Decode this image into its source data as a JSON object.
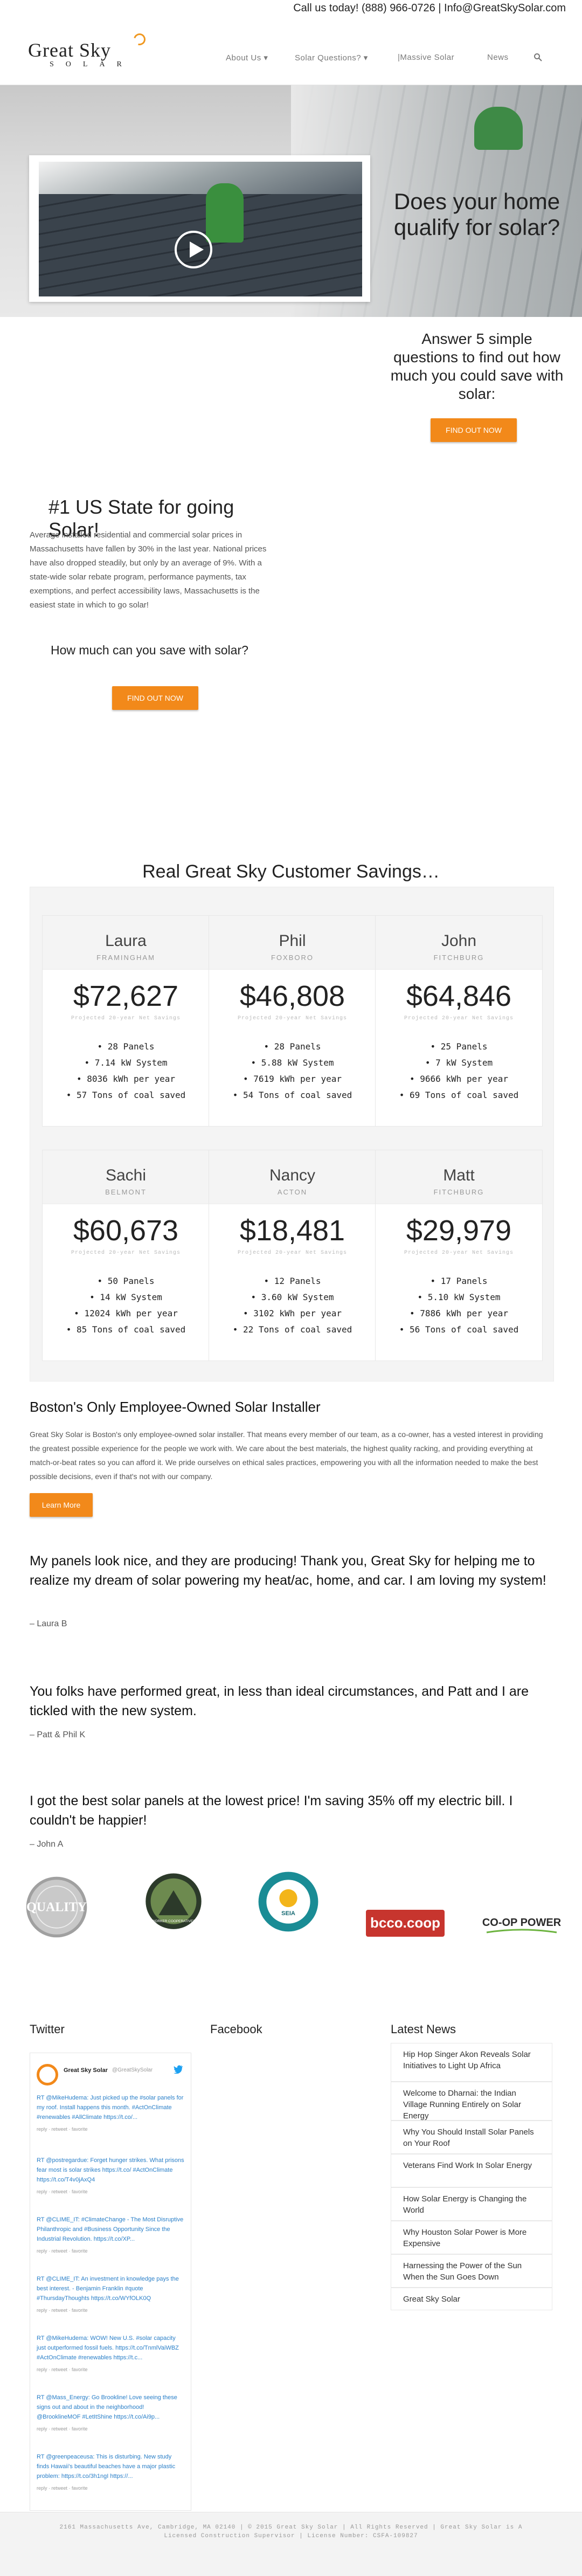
{
  "topbar": {
    "text": "Call us today! (888) 966-0726 | Info@GreatSkySolar.com"
  },
  "brand": {
    "line1": "Great Sky",
    "line2": "SOLAR"
  },
  "nav": {
    "about": "About Us ▾",
    "questions": "Solar Questions? ▾",
    "massive": "|Massive Solar",
    "news": "News",
    "search_icon": "search-icon"
  },
  "hero": {
    "headline": "Does your home qualify for solar?",
    "sub": "Answer 5 simple questions to find out how much you could save with solar:",
    "cta": "FIND OUT NOW"
  },
  "intro": {
    "title": "#1 US State for going Solar!",
    "body": "Average installed residential and commercial solar prices in Massachusetts have fallen by 30% in the last year. National prices have also dropped steadily, but only by an average of 9%. With a state-wide solar rebate program, performance payments, tax exemptions, and perfect accessibility laws, Massachusetts is the easiest state in which to go solar!",
    "question": "How much can you save with solar?",
    "cta": "FIND OUT NOW"
  },
  "savings": {
    "title": "Real Great Sky Customer Savings…",
    "note": "Projected 20-year Net Savings",
    "customers": [
      {
        "name": "Laura",
        "city": "FRAMINGHAM",
        "amount": "$72,627",
        "items": [
          "• 28 Panels",
          "• 7.14 kW System",
          "• 8036 kWh per year",
          "• 57 Tons of coal saved"
        ]
      },
      {
        "name": "Phil",
        "city": "FOXBORO",
        "amount": "$46,808",
        "items": [
          "• 28 Panels",
          "• 5.88 kW System",
          "• 7619 kWh per year",
          "• 54 Tons of coal saved"
        ]
      },
      {
        "name": "John",
        "city": "FITCHBURG",
        "amount": "$64,846",
        "items": [
          "• 25 Panels",
          "• 7 kW System",
          "• 9666 kWh per year",
          "• 69 Tons of coal saved"
        ]
      },
      {
        "name": "Sachi",
        "city": "BELMONT",
        "amount": "$60,673",
        "items": [
          "• 50 Panels",
          "• 14 kW System",
          "• 12024 kWh per year",
          "• 85 Tons of coal saved"
        ]
      },
      {
        "name": "Nancy",
        "city": "ACTON",
        "amount": "$18,481",
        "items": [
          "• 12 Panels",
          "• 3.60 kW System",
          "• 3102 kWh per year",
          "• 22 Tons of coal saved"
        ]
      },
      {
        "name": "Matt",
        "city": "FITCHBURG",
        "amount": "$29,979",
        "items": [
          "• 17 Panels",
          "• 5.10 kW System",
          "• 7886 kWh per year",
          "• 56 Tons of coal saved"
        ]
      }
    ]
  },
  "employee": {
    "title": "Boston's Only Employee-Owned Solar Installer",
    "body": "Great Sky Solar is Boston's only employee-owned solar installer. That means every member of our team, as a co-owner, has a vested interest in providing the greatest possible experience for the people we work with. We care about the best materials, the highest quality racking, and providing everything at match-or-beat rates so you can afford it. We pride ourselves on ethical sales practices, empowering you with all the information needed to make the best possible decisions, even if that's not with our company.",
    "cta": "Learn More"
  },
  "testimonials": [
    {
      "quote": "My panels look nice, and they are producing! Thank you, Great Sky for helping me to realize my dream of solar powering my heat/ac, home, and car. I am loving my system!",
      "author": "– Laura B"
    },
    {
      "quote": "You folks have performed great, in less than ideal circumstances, and Patt and I are tickled with the new system.",
      "author": "– Patt & Phil K"
    },
    {
      "quote": "I got the best solar panels at the lowest price! I'm saving 35% off my electric bill. I couldn't be happier!",
      "author": "– John A"
    }
  ],
  "logos": {
    "l1": "QUALITY",
    "l2": "WORKER COOPERATIVES",
    "l3": "SEIA",
    "l4": "bcco.coop",
    "l5": "CO-OP POWER"
  },
  "footer_cols": {
    "twitter": "Twitter",
    "facebook": "Facebook",
    "news": "Latest News"
  },
  "twitter": {
    "handle": "Great Sky Solar",
    "at": "@GreatSkySolar",
    "tweets": [
      {
        "t": "RT @MikeHudema: Just picked up the #solar panels for my roof. Install happens this month. #ActOnClimate #renewables #AllClimate https://t.co/...",
        "m": "reply · retweet · favorite"
      },
      {
        "t": "RT @postregardue: Forget hunger strikes. What prisons fear most is solar strikes https://t.co/ #ActOnClimate https://t.co/T4v0jAxQ4",
        "m": "reply · retweet · favorite"
      },
      {
        "t": "RT @CLIME_IT: #ClimateChange - The Most Disruptive Philanthropic and #Business Opportunity Since the Industrial Revolution. https://t.co/XP...",
        "m": "reply · retweet · favorite"
      },
      {
        "t": "RT @CLIME_IT: An investment in knowledge pays the best interest. - Benjamin Franklin #quote #ThursdayThoughts https://t.co/WYfOLK0Q",
        "m": "reply · retweet · favorite"
      },
      {
        "t": "RT @MikeHudema: WOW! New U.S. #solar capacity just outperformed fossil fuels. https://t.co/TnmlVaiWBZ #ActOnClimate #renewables https://t.c...",
        "m": "reply · retweet · favorite"
      },
      {
        "t": "RT @Mass_Energy: Go Brookline! Love seeing these signs out and about in the neighborhood! @BrooklineMOF #LetItShine https://t.co/Ai9p...",
        "m": "reply · retweet · favorite"
      },
      {
        "t": "RT @greenpeaceusa: This is disturbing. New study finds Hawaii's beautiful beaches have a major plastic problem: https://t.co/3h1ngI https://...",
        "m": "reply · retweet · favorite"
      }
    ]
  },
  "news": [
    "Hip Hop Singer Akon Reveals Solar Initiatives to Light Up Africa",
    "Welcome to Dharnai: the Indian Village Running Entirely on Solar Energy",
    "Why You Should Install Solar Panels on Your Roof",
    "Veterans Find Work In Solar Energy",
    "How Solar Energy is Changing the World",
    "Why Houston Solar Power is More Expensive",
    "Harnessing the Power of the Sun When the Sun Goes Down",
    "Great Sky Solar"
  ],
  "footer": {
    "text": "2161 Massachusetts Ave, Cambridge, MA 02140 | © 2015 Great Sky Solar | All Rights Reserved | Great Sky Solar is A Licensed Construction Supervisor | License Number: CSFA-109827"
  }
}
